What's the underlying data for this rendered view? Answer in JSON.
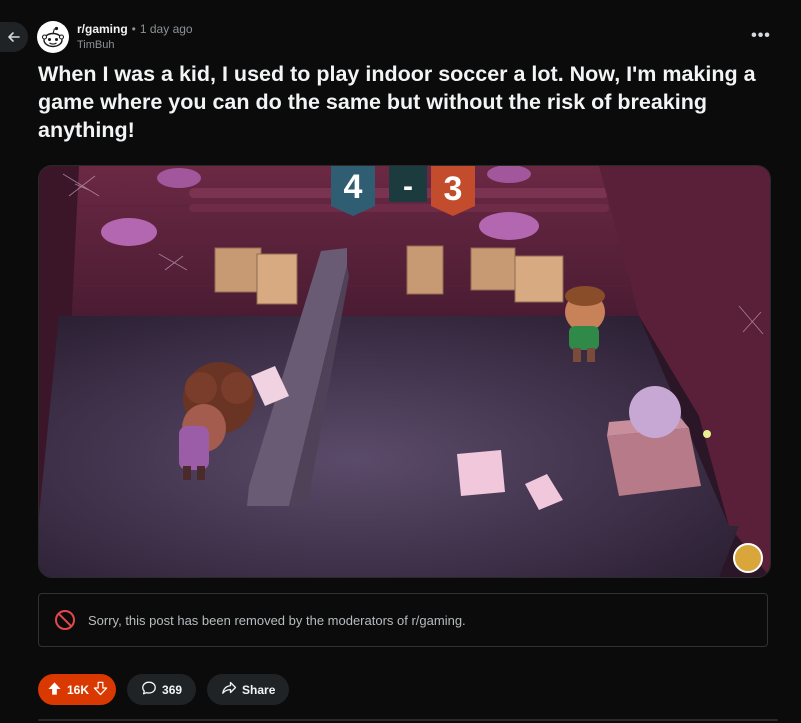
{
  "post": {
    "subreddit": "r/gaming",
    "separator": "•",
    "time_ago": "1 day ago",
    "author": "TimBuh",
    "overflow_label": "•••",
    "title": "When I was a kid, I used to play indoor soccer a lot. Now, I'm making a game where you can do the same but without the risk of breaking anything!",
    "media": {
      "score_left": "4",
      "score_dash": "-",
      "score_right": "3"
    },
    "removed_notice": "Sorry, this post has been removed by the moderators of r/gaming.",
    "actions": {
      "upvotes": "16K",
      "comments": "369",
      "share_label": "Share"
    }
  },
  "icons": {
    "back": "arrow-left-icon",
    "avatar": "reddit-snoo-icon",
    "removed": "prohibited-icon",
    "upvote": "arrow-up-icon",
    "downvote": "arrow-down-icon",
    "comment": "comment-bubble-icon",
    "share": "share-arrow-icon"
  },
  "colors": {
    "background": "#0b0b0b",
    "upvote_pill": "#d93900",
    "pill": "#1f2326",
    "removed_icon": "#e5474a"
  }
}
